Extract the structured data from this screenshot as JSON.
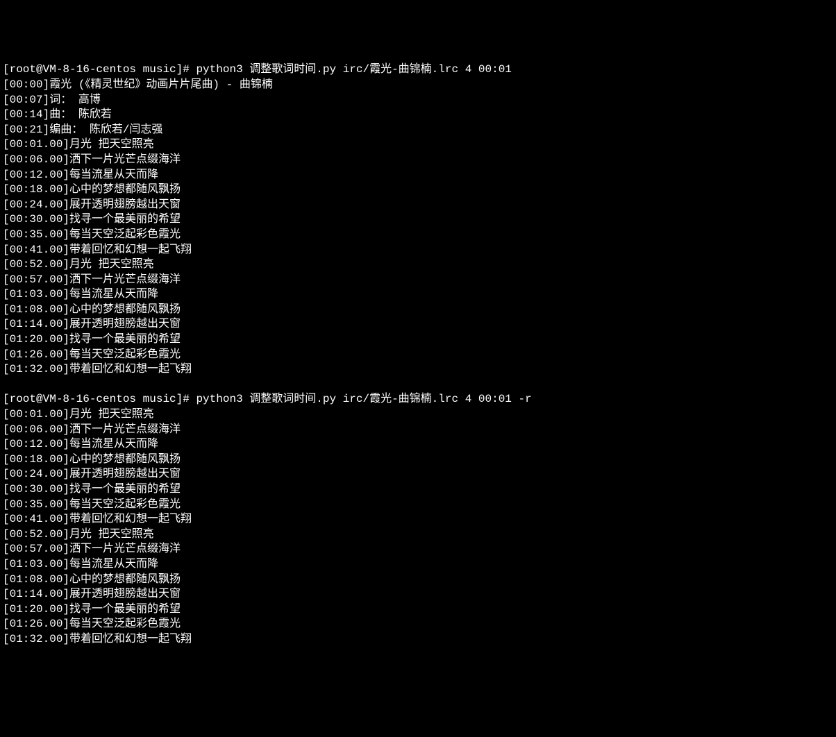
{
  "terminal": {
    "lines": [
      {
        "type": "command",
        "prompt": "[root@VM-8-16-centos music]# ",
        "cmd": "python3 调整歌词时间.py irc/霞光-曲锦楠.lrc 4 00:01"
      },
      {
        "type": "output",
        "text": "[00:00]霞光 (《精灵世纪》动画片片尾曲) - 曲锦楠"
      },
      {
        "type": "output",
        "text": "[00:07]词： 高博"
      },
      {
        "type": "output",
        "text": "[00:14]曲： 陈欣若"
      },
      {
        "type": "output",
        "text": "[00:21]编曲： 陈欣若/闫志强"
      },
      {
        "type": "output",
        "text": "[00:01.00]月光 把天空照亮"
      },
      {
        "type": "output",
        "text": "[00:06.00]洒下一片光芒点缀海洋"
      },
      {
        "type": "output",
        "text": "[00:12.00]每当流星从天而降"
      },
      {
        "type": "output",
        "text": "[00:18.00]心中的梦想都随风飘扬"
      },
      {
        "type": "output",
        "text": "[00:24.00]展开透明翅膀越出天窗"
      },
      {
        "type": "output",
        "text": "[00:30.00]找寻一个最美丽的希望"
      },
      {
        "type": "output",
        "text": "[00:35.00]每当天空泛起彩色霞光"
      },
      {
        "type": "output",
        "text": "[00:41.00]带着回忆和幻想一起飞翔"
      },
      {
        "type": "output",
        "text": "[00:52.00]月光 把天空照亮"
      },
      {
        "type": "output",
        "text": "[00:57.00]洒下一片光芒点缀海洋"
      },
      {
        "type": "output",
        "text": "[01:03.00]每当流星从天而降"
      },
      {
        "type": "output",
        "text": "[01:08.00]心中的梦想都随风飘扬"
      },
      {
        "type": "output",
        "text": "[01:14.00]展开透明翅膀越出天窗"
      },
      {
        "type": "output",
        "text": "[01:20.00]找寻一个最美丽的希望"
      },
      {
        "type": "output",
        "text": "[01:26.00]每当天空泛起彩色霞光"
      },
      {
        "type": "output",
        "text": "[01:32.00]带着回忆和幻想一起飞翔"
      },
      {
        "type": "output",
        "text": ""
      },
      {
        "type": "command",
        "prompt": "[root@VM-8-16-centos music]# ",
        "cmd": "python3 调整歌词时间.py irc/霞光-曲锦楠.lrc 4 00:01 -r"
      },
      {
        "type": "output",
        "text": "[00:01.00]月光 把天空照亮"
      },
      {
        "type": "output",
        "text": "[00:06.00]洒下一片光芒点缀海洋"
      },
      {
        "type": "output",
        "text": "[00:12.00]每当流星从天而降"
      },
      {
        "type": "output",
        "text": "[00:18.00]心中的梦想都随风飘扬"
      },
      {
        "type": "output",
        "text": "[00:24.00]展开透明翅膀越出天窗"
      },
      {
        "type": "output",
        "text": "[00:30.00]找寻一个最美丽的希望"
      },
      {
        "type": "output",
        "text": "[00:35.00]每当天空泛起彩色霞光"
      },
      {
        "type": "output",
        "text": "[00:41.00]带着回忆和幻想一起飞翔"
      },
      {
        "type": "output",
        "text": "[00:52.00]月光 把天空照亮"
      },
      {
        "type": "output",
        "text": "[00:57.00]洒下一片光芒点缀海洋"
      },
      {
        "type": "output",
        "text": "[01:03.00]每当流星从天而降"
      },
      {
        "type": "output",
        "text": "[01:08.00]心中的梦想都随风飘扬"
      },
      {
        "type": "output",
        "text": "[01:14.00]展开透明翅膀越出天窗"
      },
      {
        "type": "output",
        "text": "[01:20.00]找寻一个最美丽的希望"
      },
      {
        "type": "output",
        "text": "[01:26.00]每当天空泛起彩色霞光"
      },
      {
        "type": "output",
        "text": "[01:32.00]带着回忆和幻想一起飞翔"
      }
    ]
  }
}
